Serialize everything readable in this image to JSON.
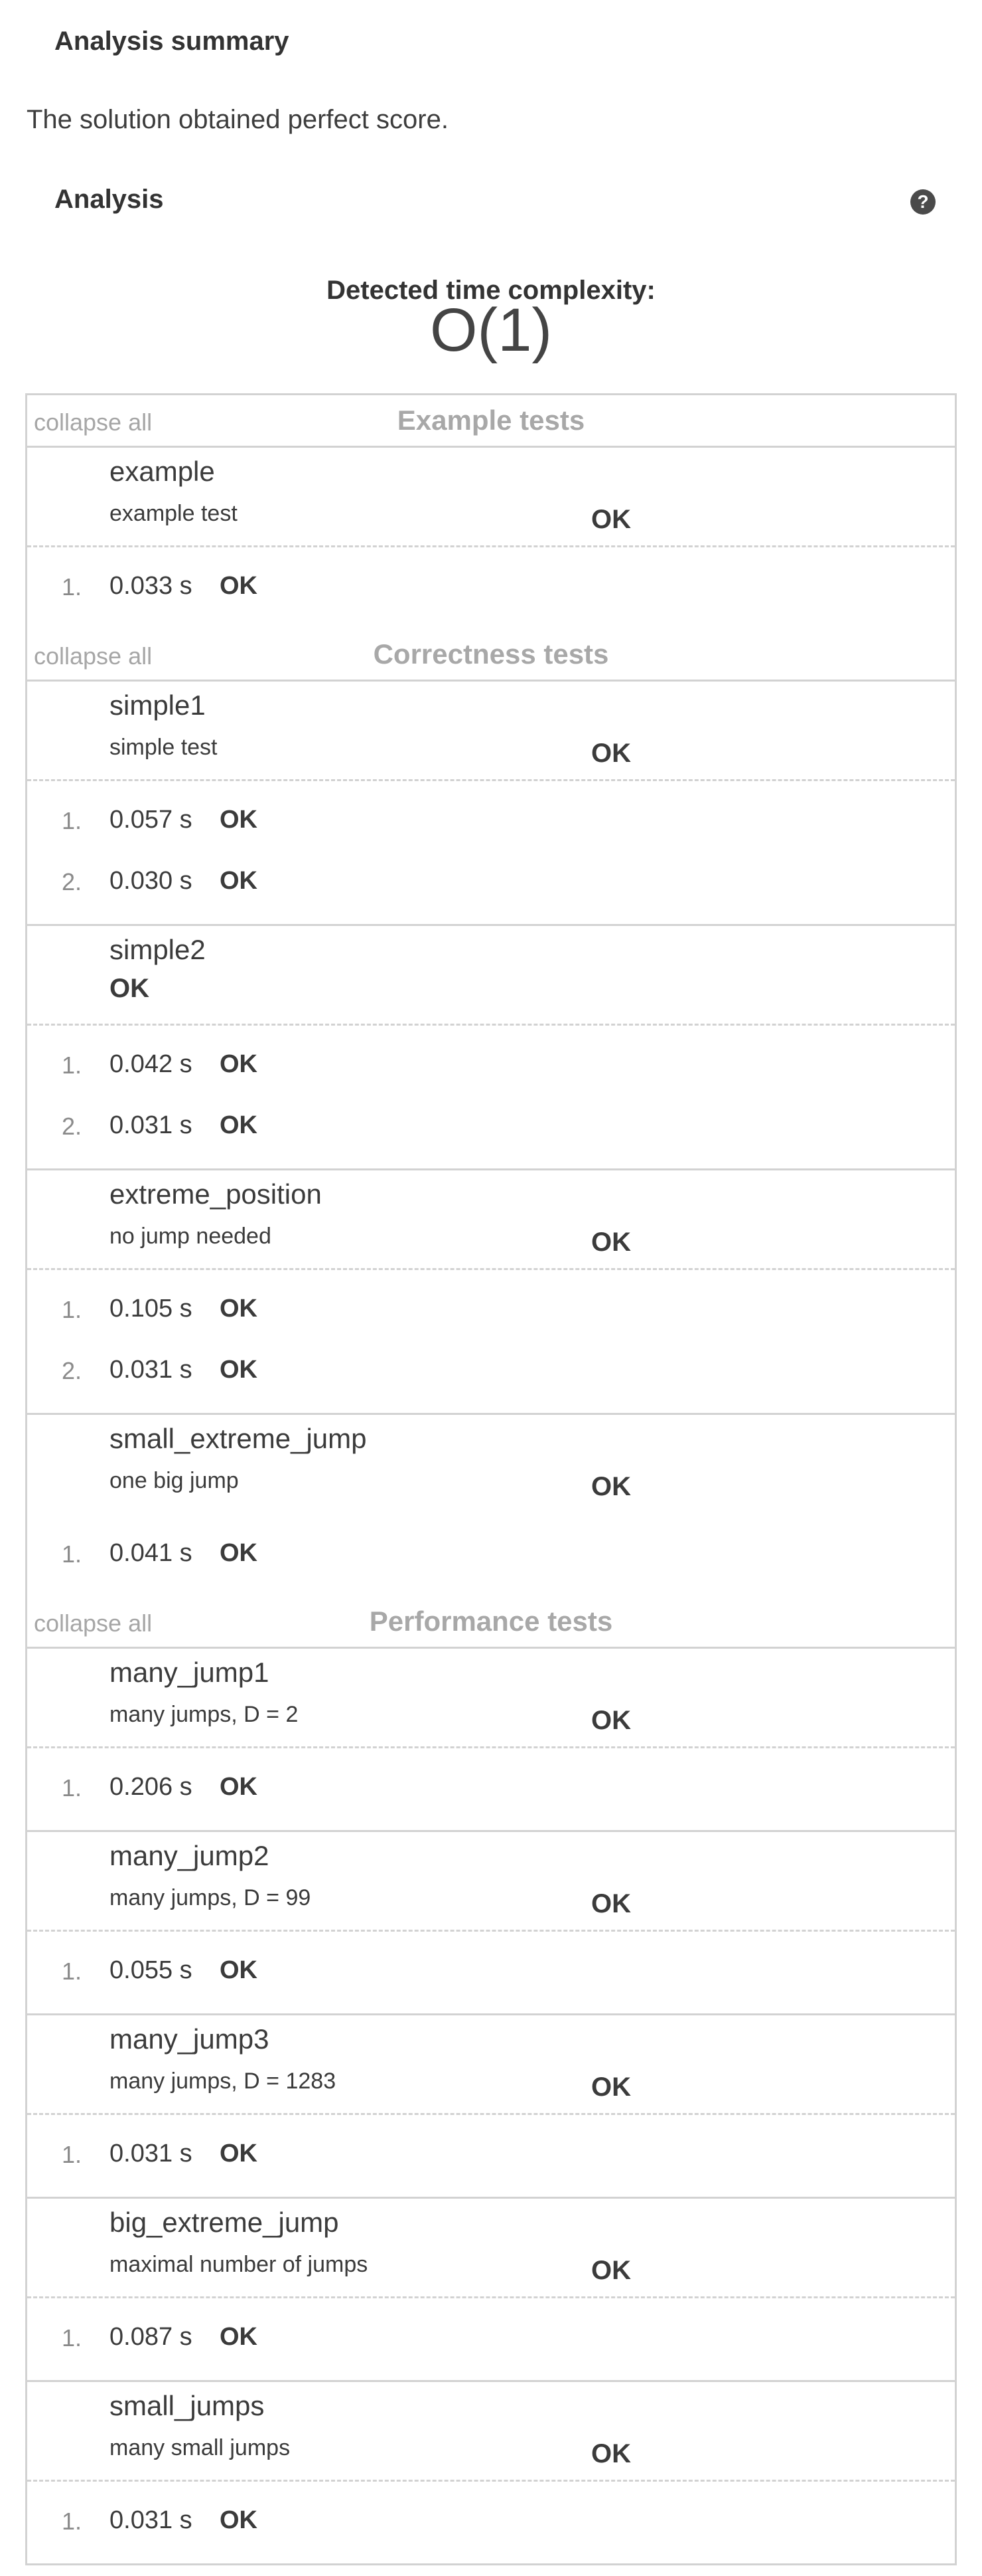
{
  "summary": {
    "heading": "Analysis summary",
    "text": "The solution obtained perfect score."
  },
  "analysis": {
    "heading": "Analysis",
    "help_icon": "question-circle-icon",
    "complexity_label": "Detected time complexity:",
    "complexity_value": "O(1)"
  },
  "groups": [
    {
      "title": "Example tests",
      "collapse_label": "collapse all",
      "tests": [
        {
          "name": "example",
          "desc": "example test",
          "result": "OK",
          "runs": [
            {
              "index": "1.",
              "time": "0.033 s",
              "status": "OK"
            }
          ]
        }
      ]
    },
    {
      "title": "Correctness tests",
      "collapse_label": "collapse all",
      "tests": [
        {
          "name": "simple1",
          "desc": "simple test",
          "result": "OK",
          "runs": [
            {
              "index": "1.",
              "time": "0.057 s",
              "status": "OK"
            },
            {
              "index": "2.",
              "time": "0.030 s",
              "status": "OK"
            }
          ]
        },
        {
          "name": "simple2",
          "desc": "",
          "result": "OK",
          "runs": [
            {
              "index": "1.",
              "time": "0.042 s",
              "status": "OK"
            },
            {
              "index": "2.",
              "time": "0.031 s",
              "status": "OK"
            }
          ]
        },
        {
          "name": "extreme_position",
          "desc": "no jump needed",
          "result": "OK",
          "runs": [
            {
              "index": "1.",
              "time": "0.105 s",
              "status": "OK"
            },
            {
              "index": "2.",
              "time": "0.031 s",
              "status": "OK"
            }
          ]
        },
        {
          "name": "small_extreme_jump",
          "desc": "one big jump",
          "result": "OK",
          "noDivider": true,
          "runs": [
            {
              "index": "1.",
              "time": "0.041 s",
              "status": "OK"
            }
          ]
        }
      ]
    },
    {
      "title": "Performance tests",
      "collapse_label": "collapse all",
      "tests": [
        {
          "name": "many_jump1",
          "desc": "many jumps, D = 2",
          "result": "OK",
          "runs": [
            {
              "index": "1.",
              "time": "0.206 s",
              "status": "OK"
            }
          ]
        },
        {
          "name": "many_jump2",
          "desc": "many jumps, D = 99",
          "result": "OK",
          "runs": [
            {
              "index": "1.",
              "time": "0.055 s",
              "status": "OK"
            }
          ]
        },
        {
          "name": "many_jump3",
          "desc": "many jumps, D = 1283",
          "result": "OK",
          "runs": [
            {
              "index": "1.",
              "time": "0.031 s",
              "status": "OK"
            }
          ]
        },
        {
          "name": "big_extreme_jump",
          "desc": "maximal number of jumps",
          "result": "OK",
          "runs": [
            {
              "index": "1.",
              "time": "0.087 s",
              "status": "OK"
            }
          ]
        },
        {
          "name": "small_jumps",
          "desc": "many small jumps",
          "result": "OK",
          "runs": [
            {
              "index": "1.",
              "time": "0.031 s",
              "status": "OK"
            }
          ]
        }
      ]
    }
  ]
}
